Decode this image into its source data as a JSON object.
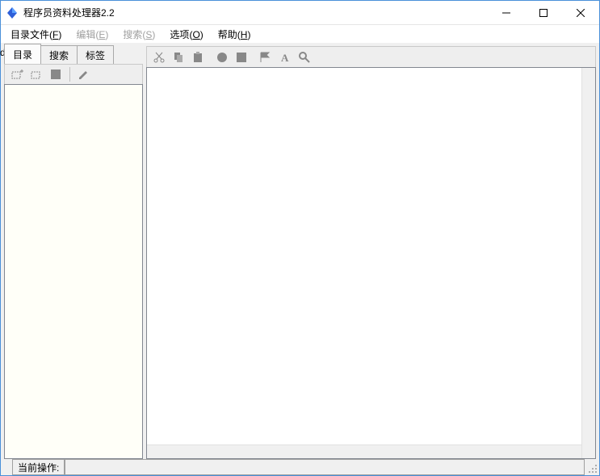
{
  "titlebar": {
    "title": "程序员资料处理器2.2"
  },
  "menubar": {
    "cut_letter": "d",
    "items": [
      {
        "label": "目录文件",
        "accel": "F",
        "disabled": false
      },
      {
        "label": "编辑",
        "accel": "E",
        "disabled": true
      },
      {
        "label": "搜索",
        "accel": "S",
        "disabled": true
      },
      {
        "label": "选项",
        "accel": "O",
        "disabled": false
      },
      {
        "label": "帮助",
        "accel": "H",
        "disabled": false
      }
    ]
  },
  "left": {
    "tabs": [
      {
        "label": "目录",
        "active": true
      },
      {
        "label": "搜索",
        "active": false
      },
      {
        "label": "标签",
        "active": false
      }
    ],
    "toolbar": {
      "icons": [
        "new-folder-plus",
        "new-folder",
        "stop",
        "edit"
      ]
    }
  },
  "right": {
    "toolbar": {
      "icons": [
        "cut",
        "copy",
        "paste",
        "circle",
        "square",
        "flag",
        "text-a",
        "zoom"
      ]
    }
  },
  "statusbar": {
    "label": "当前操作:",
    "value": ""
  }
}
